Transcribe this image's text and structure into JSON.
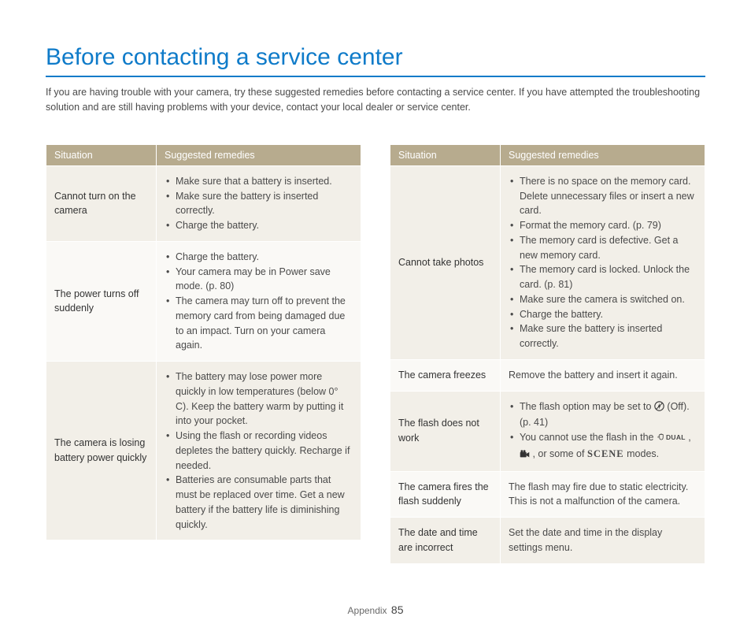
{
  "title": "Before contacting a service center",
  "intro": "If you are having trouble with your camera, try these suggested remedies before contacting a service center. If you have attempted the troubleshooting solution and are still having problems with your device, contact your local dealer or service center.",
  "headers": {
    "situation": "Situation",
    "remedies": "Suggested remedies"
  },
  "left": [
    {
      "situation": "Cannot turn on the camera",
      "bullets": [
        "Make sure that a battery is inserted.",
        "Make sure the battery is inserted correctly.",
        "Charge the battery."
      ]
    },
    {
      "situation": "The power turns off suddenly",
      "bullets": [
        "Charge the battery.",
        "Your camera may be in Power save mode. (p. 80)",
        "The camera may turn off to prevent the memory card from being damaged due to an impact. Turn on your camera again."
      ]
    },
    {
      "situation": "The camera is losing battery power quickly",
      "bullets": [
        "The battery may lose power more quickly in low temperatures (below 0° C). Keep the battery warm by putting it into your pocket.",
        "Using the flash or recording videos depletes the battery quickly. Recharge if needed.",
        "Batteries are consumable parts that must be replaced over time. Get a new battery if the battery life is diminishing quickly."
      ]
    }
  ],
  "right": [
    {
      "situation": "Cannot take photos",
      "bullets": [
        "There is no space on the memory card. Delete unnecessary files or insert a new card.",
        "Format the memory card. (p. 79)",
        "The memory card is defective. Get a new memory card.",
        "The memory card is locked. Unlock the card. (p. 81)",
        "Make sure the camera is switched on.",
        "Charge the battery.",
        "Make sure the battery is inserted correctly."
      ]
    },
    {
      "situation": "The camera freezes",
      "text": "Remove the battery and insert it again."
    },
    {
      "situation": "The flash does not work",
      "flash_bullets": {
        "b1_pre": "The flash option may be set to ",
        "b1_post": " (Off). (p. 41)",
        "b2_pre": "You cannot use the flash in the ",
        "b2_mid": ", ",
        "b2_mid2": ", or some of ",
        "b2_scene": "SCENE",
        "b2_end": " modes."
      }
    },
    {
      "situation": "The camera fires the flash suddenly",
      "text": "The flash may fire due to static electricity. This is not a malfunction of the camera."
    },
    {
      "situation": "The date and time are incorrect",
      "text": "Set the date and time in the display settings menu."
    }
  ],
  "footer": {
    "section": "Appendix",
    "page": "85"
  }
}
